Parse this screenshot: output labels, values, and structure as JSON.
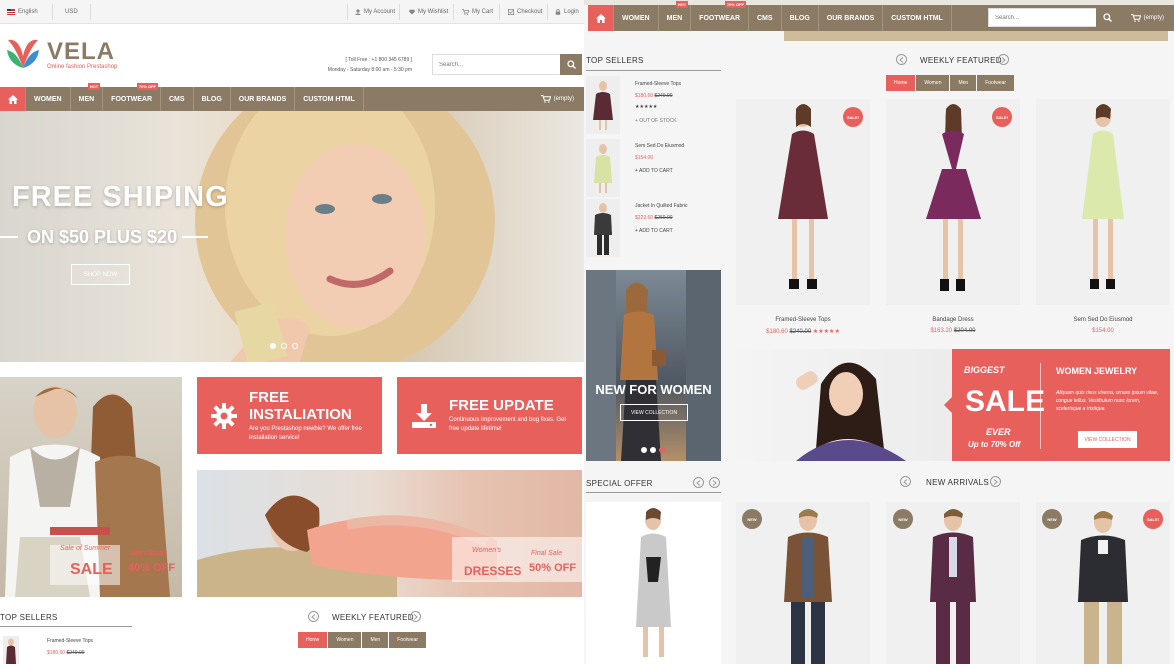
{
  "top_bar": {
    "language": "English",
    "currency": "USD",
    "links": [
      "My Account",
      "My Wishlist",
      "My Cart",
      "Checkout",
      "Login"
    ]
  },
  "header": {
    "logo": "VELA",
    "tagline": "Online fashion Prestashop",
    "phone": "[ Toll Free : +1 800 345 6789 ]",
    "hours": "Monday - Saturday 8:00 am - 5:30 pm",
    "search_placeholder": "Search..."
  },
  "nav": {
    "items": [
      "WOMEN",
      "MEN",
      "FOOTWEAR",
      "CMS",
      "BLOG",
      "OUR BRANDS",
      "CUSTOM HTML"
    ],
    "badges": {
      "men": "Hot",
      "footwear": "70% Off"
    },
    "cart": "(empty)"
  },
  "hero": {
    "title": "FREE SHIPING",
    "subtitle": "ON $50 PLUS $20",
    "button": "SHOP NOW"
  },
  "promos": [
    {
      "title": "FREE INSTALIATION",
      "text": "Are you Prestashop newbie? We offer free installation service!"
    },
    {
      "title": "FREE UPDATE",
      "text": "Continuous improvement and bug fixes. Get free update lifetime!"
    }
  ],
  "banners": {
    "summer": {
      "script": "Sale of Summer",
      "main": "SALE",
      "script2": "Jean Shorts",
      "main2": "40% OFF"
    },
    "dresses": {
      "script": "Women's",
      "main": "DRESSES",
      "script2": "Final Sale",
      "main2": "50% OFF"
    }
  },
  "left_bottom": {
    "top_sellers": "TOP SELLERS",
    "weekly_featured": "WEEKLY FEATURED",
    "tabs": [
      "Home",
      "Women",
      "Men",
      "Footwear"
    ],
    "product_name": "Framed-Sleeve Tops",
    "price": "$180.60",
    "old_price": "$240.00"
  },
  "top_sellers": [
    {
      "name": "Framed-Sleeve Tops",
      "price": "$180.60",
      "old_price": "$240.00",
      "stars": "★★★★★",
      "action": "+ OUT OF STOCK"
    },
    {
      "name": "Sem Sed Do Eiusmod",
      "price": "$154.00",
      "old_price": "",
      "action": "+ ADD TO CART"
    },
    {
      "name": "Jacket In Quilted Fabric",
      "price": "$223.60",
      "old_price": "$260.00",
      "action": "+ ADD TO CART"
    }
  ],
  "women_banner": {
    "title": "NEW FOR WOMEN",
    "button": "VIEW COLLECTION"
  },
  "special_offer": "SPECIAL OFFER",
  "weekly_featured": {
    "title": "WEEKLY FEATURED",
    "tabs": [
      "Home",
      "Women",
      "Men",
      "Footwear"
    ],
    "badge": "SALE!",
    "products": [
      {
        "name": "Framed-Sleeve Tops",
        "price": "$180.60",
        "old_price": "$240.00",
        "stars": "★★★★★",
        "sale": true
      },
      {
        "name": "Bandage Dress",
        "price": "$163.20",
        "old_price": "$204.00",
        "stars": "",
        "sale": true
      },
      {
        "name": "Sem Sed Do Eiusmod",
        "price": "$154.00",
        "old_price": "",
        "stars": "",
        "sale": false
      }
    ]
  },
  "sale_banner": {
    "kicker": "BIGGEST",
    "big": "SALE",
    "ever": "EVER",
    "upto": "Up to 70% Off",
    "heading": "WOMEN JEWELRY",
    "text": "Aliquam quis risus viverra, ornare ipsum vitae, congue tellus. Vestibulum nunc lorem, scelerisque a tristique.",
    "button": "VIEW COLLECTION"
  },
  "new_arrivals": {
    "title": "NEW ARRIVALS",
    "badge_new": "NEW",
    "badge_sale": "SALE!"
  },
  "colors": {
    "accent": "#e8605c",
    "brand": "#8b7a64"
  }
}
